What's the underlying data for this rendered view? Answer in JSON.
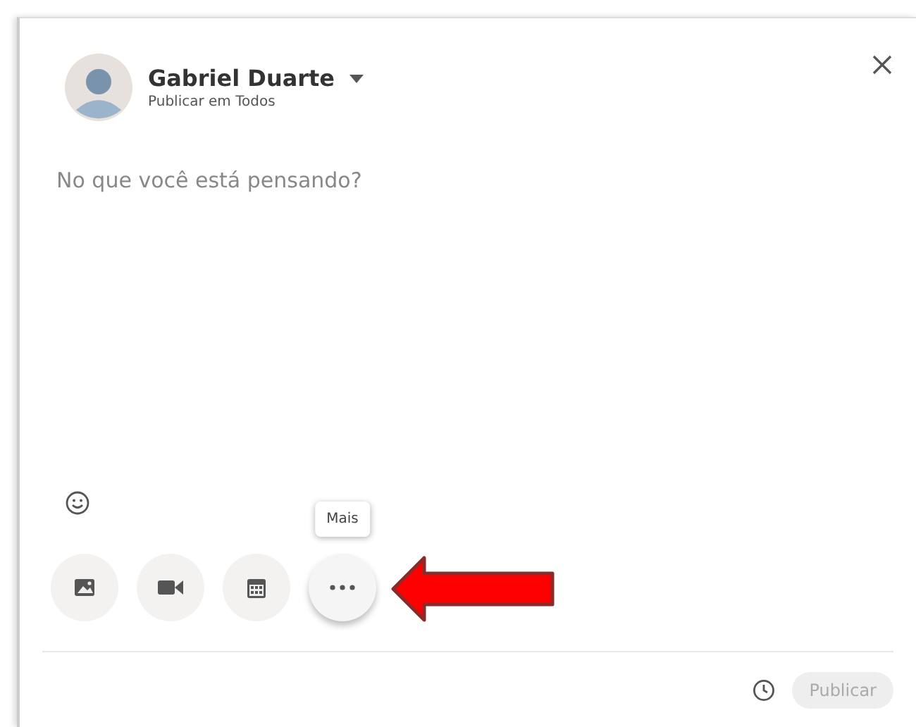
{
  "author": {
    "name": "Gabriel Duarte",
    "audience": "Publicar em Todos"
  },
  "editor": {
    "placeholder": "No que você está pensando?"
  },
  "attachments": [
    {
      "kind": "photo"
    },
    {
      "kind": "video"
    },
    {
      "kind": "event"
    },
    {
      "kind": "more",
      "tooltip": "Mais"
    }
  ],
  "footer": {
    "publish": {
      "label": "Publicar",
      "disabled": true
    }
  }
}
